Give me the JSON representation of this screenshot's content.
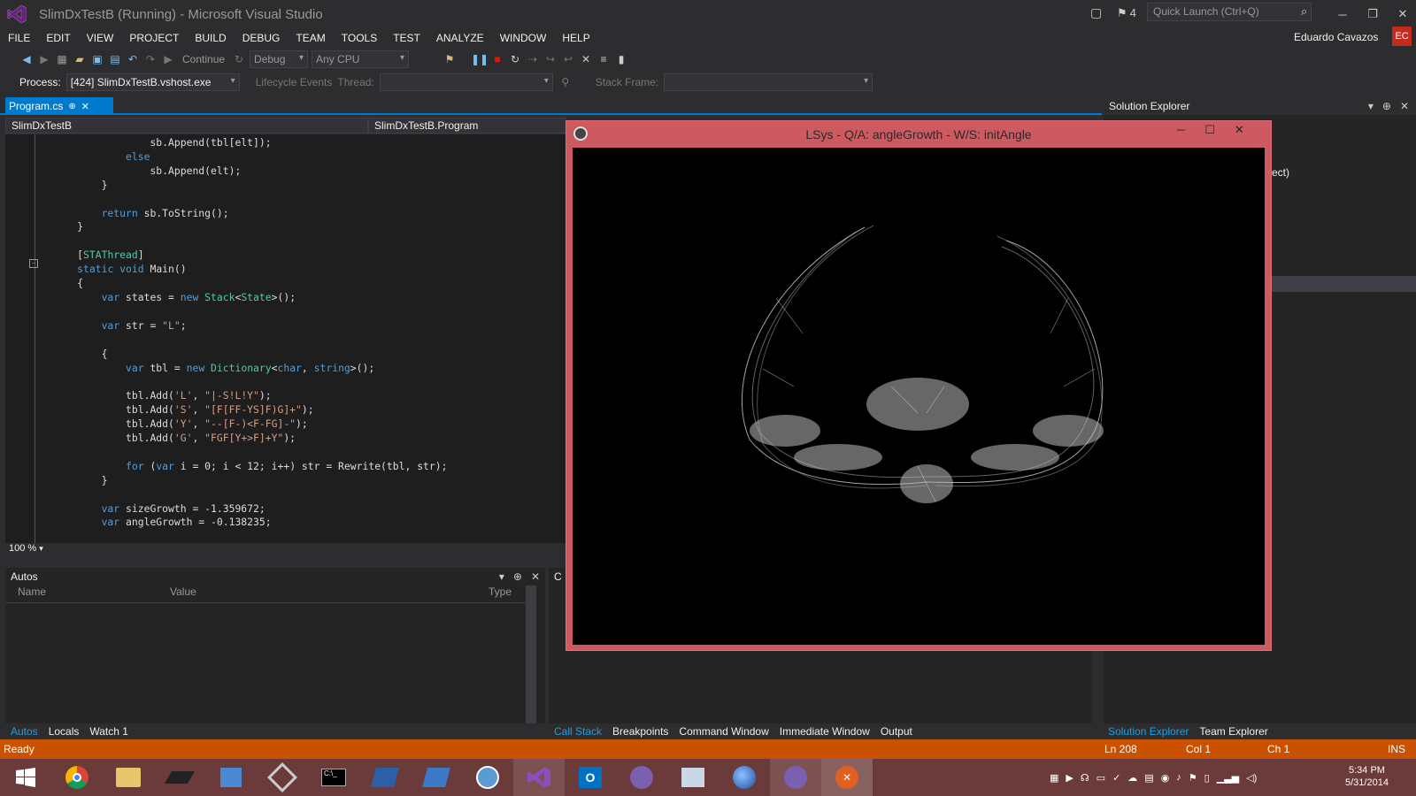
{
  "window": {
    "title": "SlimDxTestB (Running) - Microsoft Visual Studio",
    "notifications": "4",
    "quick_launch": "Quick Launch (Ctrl+Q)"
  },
  "menu": [
    "FILE",
    "EDIT",
    "VIEW",
    "PROJECT",
    "BUILD",
    "DEBUG",
    "TEAM",
    "TOOLS",
    "TEST",
    "ANALYZE",
    "WINDOW",
    "HELP"
  ],
  "user": {
    "name": "Eduardo Cavazos",
    "initials": "EC"
  },
  "toolbar": {
    "continue": "Continue",
    "config": "Debug",
    "platform": "Any CPU"
  },
  "debugbar": {
    "process_label": "Process:",
    "process": "[424] SlimDxTestB.vshost.exe",
    "lifecycle": "Lifecycle Events",
    "thread_label": "Thread:",
    "stack_label": "Stack Frame:"
  },
  "tabs": {
    "active": "Program.cs"
  },
  "nav": {
    "project": "SlimDxTestB",
    "class": "SlimDxTestB.Program"
  },
  "code": [
    "            sb.Append(tbl[elt]);",
    "        else",
    "            sb.Append(elt);",
    "    }",
    "",
    "    return sb.ToString();",
    "}",
    "",
    "[STAThread]",
    "static void Main()",
    "{",
    "    var states = new Stack<State>();",
    "",
    "    var str = \"L\";",
    "",
    "    {",
    "        var tbl = new Dictionary<char, string>();",
    "",
    "        tbl.Add('L', \"|-S!L!Y\");",
    "        tbl.Add('S', \"[F[FF-YS]F)G]+\");",
    "        tbl.Add('Y', \"--[F-)<F-FG]-\");",
    "        tbl.Add('G', \"FGF[Y+>F]+Y\");",
    "",
    "        for (var i = 0; i < 12; i++) str = Rewrite(tbl, str);",
    "    }",
    "",
    "    var sizeGrowth = -1.359672;",
    "    var angleGrowth = -0.138235;"
  ],
  "zoom": "100 %",
  "autos": {
    "title": "Autos",
    "col_name": "Name",
    "col_value": "Value",
    "col_type": "Type",
    "tabs": [
      "Autos",
      "Locals",
      "Watch 1"
    ]
  },
  "callstack": {
    "title": "C",
    "tabs": [
      "Call Stack",
      "Breakpoints",
      "Command Window",
      "Immediate Window",
      "Output"
    ]
  },
  "solution": {
    "title": "Solution Explorer",
    "fragment": "ect)",
    "tabs": [
      "Solution Explorer",
      "Team Explorer"
    ]
  },
  "app_window": {
    "title": "LSys - Q/A: angleGrowth - W/S: initAngle"
  },
  "status": {
    "ready": "Ready",
    "ln": "Ln 208",
    "col": "Col 1",
    "ch": "Ch 1",
    "mode": "INS"
  },
  "clock": {
    "time": "5:34 PM",
    "date": "5/31/2014"
  }
}
